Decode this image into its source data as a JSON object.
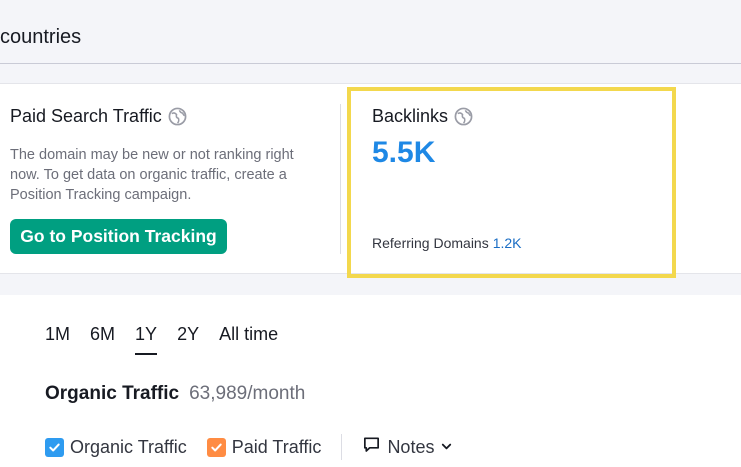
{
  "header": {
    "title": "countries"
  },
  "paid_search": {
    "title": "Paid Search Traffic",
    "description": "The domain may be new or not ranking right now. To get data on organic traffic, create a Position Tracking campaign.",
    "button_label": "Go to Position Tracking",
    "info_icon": "globe-icon"
  },
  "backlinks": {
    "title": "Backlinks",
    "value": "5.5K",
    "referring_label": "Referring Domains",
    "referring_value": "1.2K",
    "info_icon": "globe-icon"
  },
  "periods": [
    {
      "label": "1M",
      "active": false
    },
    {
      "label": "6M",
      "active": false
    },
    {
      "label": "1Y",
      "active": true
    },
    {
      "label": "2Y",
      "active": false
    },
    {
      "label": "All time",
      "active": false
    }
  ],
  "organic": {
    "label": "Organic Traffic",
    "value": "63,989/month"
  },
  "legend": {
    "organic": {
      "label": "Organic Traffic",
      "checked": true,
      "color": "#2e9bf0"
    },
    "paid": {
      "label": "Paid Traffic",
      "checked": true,
      "color": "#ff8c43"
    },
    "notes": {
      "label": "Notes"
    }
  },
  "colors": {
    "accent_green": "#009f81",
    "value_blue": "#1e88e5",
    "highlight": "#f3d84d"
  }
}
